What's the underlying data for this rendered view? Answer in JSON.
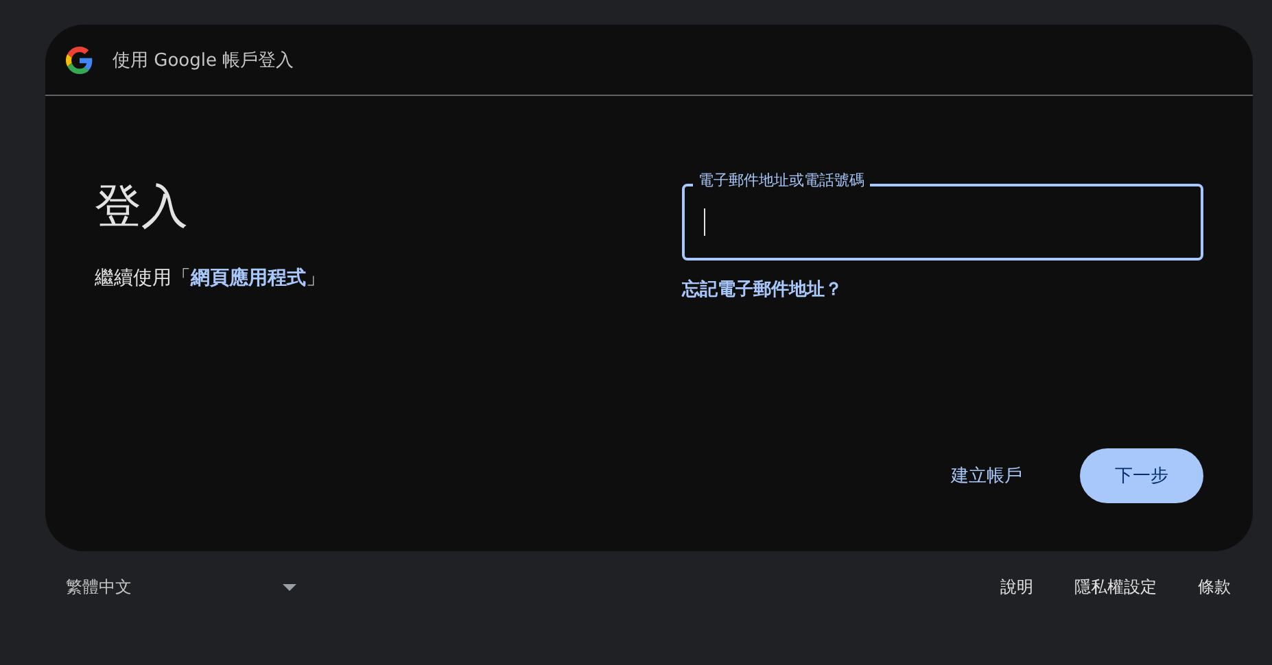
{
  "header": {
    "title": "使用 Google 帳戶登入"
  },
  "heading": "登入",
  "subtitle": "繼續使用「**網頁應用程式**」",
  "email_field": {
    "label": "電子郵件地址或電話號碼",
    "focused": true
  },
  "forgot_link": "忘記電子郵件地址？",
  "buttons": [
    {
      "label": "建立帳戶",
      "kind": "text"
    },
    {
      "label": "下一步",
      "kind": "filled"
    }
  ],
  "footer": {
    "language": "繁體中文",
    "links": [
      "說明",
      "隱私權設定",
      "條款"
    ]
  }
}
